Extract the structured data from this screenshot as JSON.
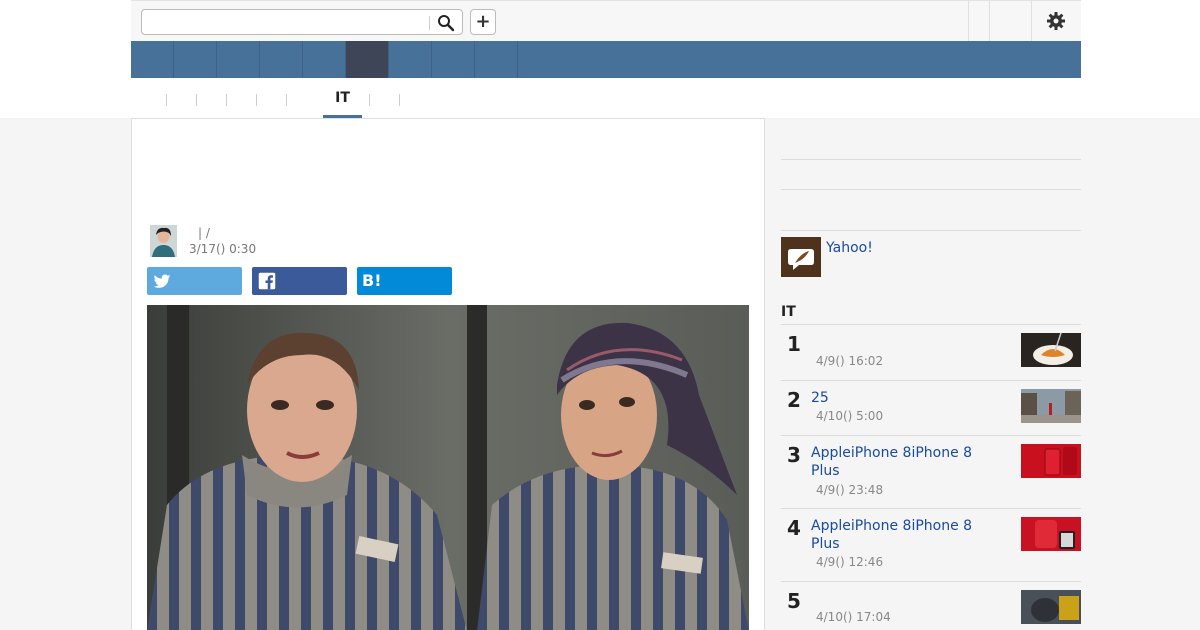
{
  "header": {
    "search_placeholder": "",
    "plus_label": "+"
  },
  "subnav": {
    "active_label": "IT"
  },
  "article": {
    "title": "",
    "byline": " | /",
    "datetime": "3/17() 0:30",
    "share": {
      "hatena_label": "B!"
    }
  },
  "sidebar": {
    "promo_label": "Yahoo!",
    "ranking_heading": "IT",
    "ranking": [
      {
        "num": "1",
        "title": "",
        "date": "4/9() 16:02"
      },
      {
        "num": "2",
        "title": "25",
        "date": "4/10() 5:00"
      },
      {
        "num": "3",
        "title": "AppleiPhone 8iPhone 8 Plus",
        "date": "4/9() 23:48"
      },
      {
        "num": "4",
        "title": "AppleiPhone 8iPhone 8 Plus",
        "date": "4/9() 12:46"
      },
      {
        "num": "5",
        "title": "",
        "date": "4/10() 17:04"
      }
    ]
  },
  "colors": {
    "nav": "#48719a",
    "nav_active": "#3e4556",
    "twitter": "#5ea9dd",
    "facebook": "#3b5a9a",
    "hatena": "#028ad9",
    "link": "#1a4aa0"
  }
}
